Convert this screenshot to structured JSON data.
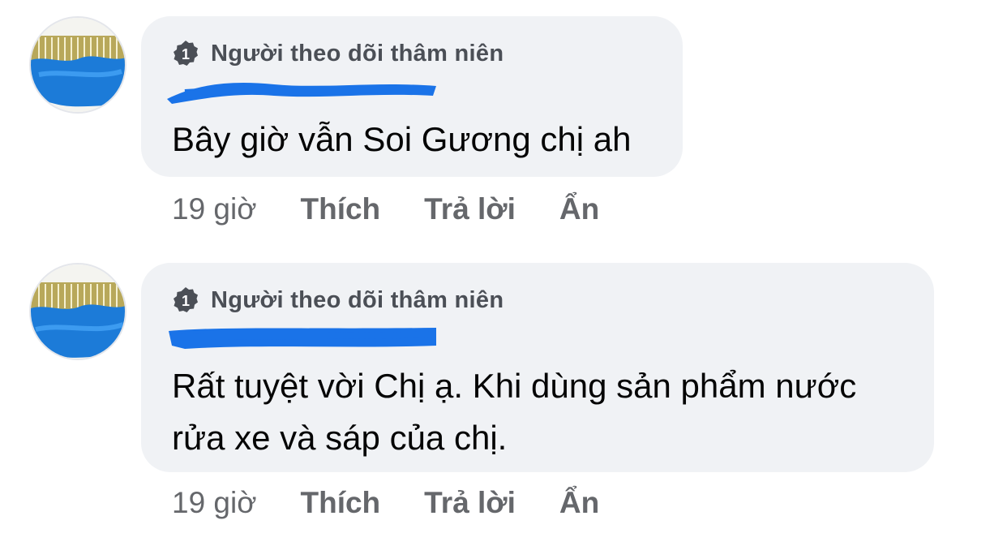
{
  "comments": [
    {
      "badge_label": "Người theo dõi thâm niên",
      "text": "Bây giờ vẫn Soi Gương chị ah",
      "time": "19 giờ",
      "like_label": "Thích",
      "reply_label": "Trả lời",
      "hide_label": "Ẩn"
    },
    {
      "badge_label": "Người theo dõi thâm niên",
      "text": "Rất tuyệt vời Chị ạ. Khi dùng sản phẩm nước rửa xe và sáp của chị.",
      "time": "19 giờ",
      "like_label": "Thích",
      "reply_label": "Trả lời",
      "hide_label": "Ẩn"
    }
  ],
  "colors": {
    "bubble_bg": "#f0f2f5",
    "meta_text": "#65676b",
    "badge_icon": "#4b4f56",
    "redaction": "#1a73e8"
  },
  "icons": {
    "badge": "top-fan-badge-icon"
  }
}
